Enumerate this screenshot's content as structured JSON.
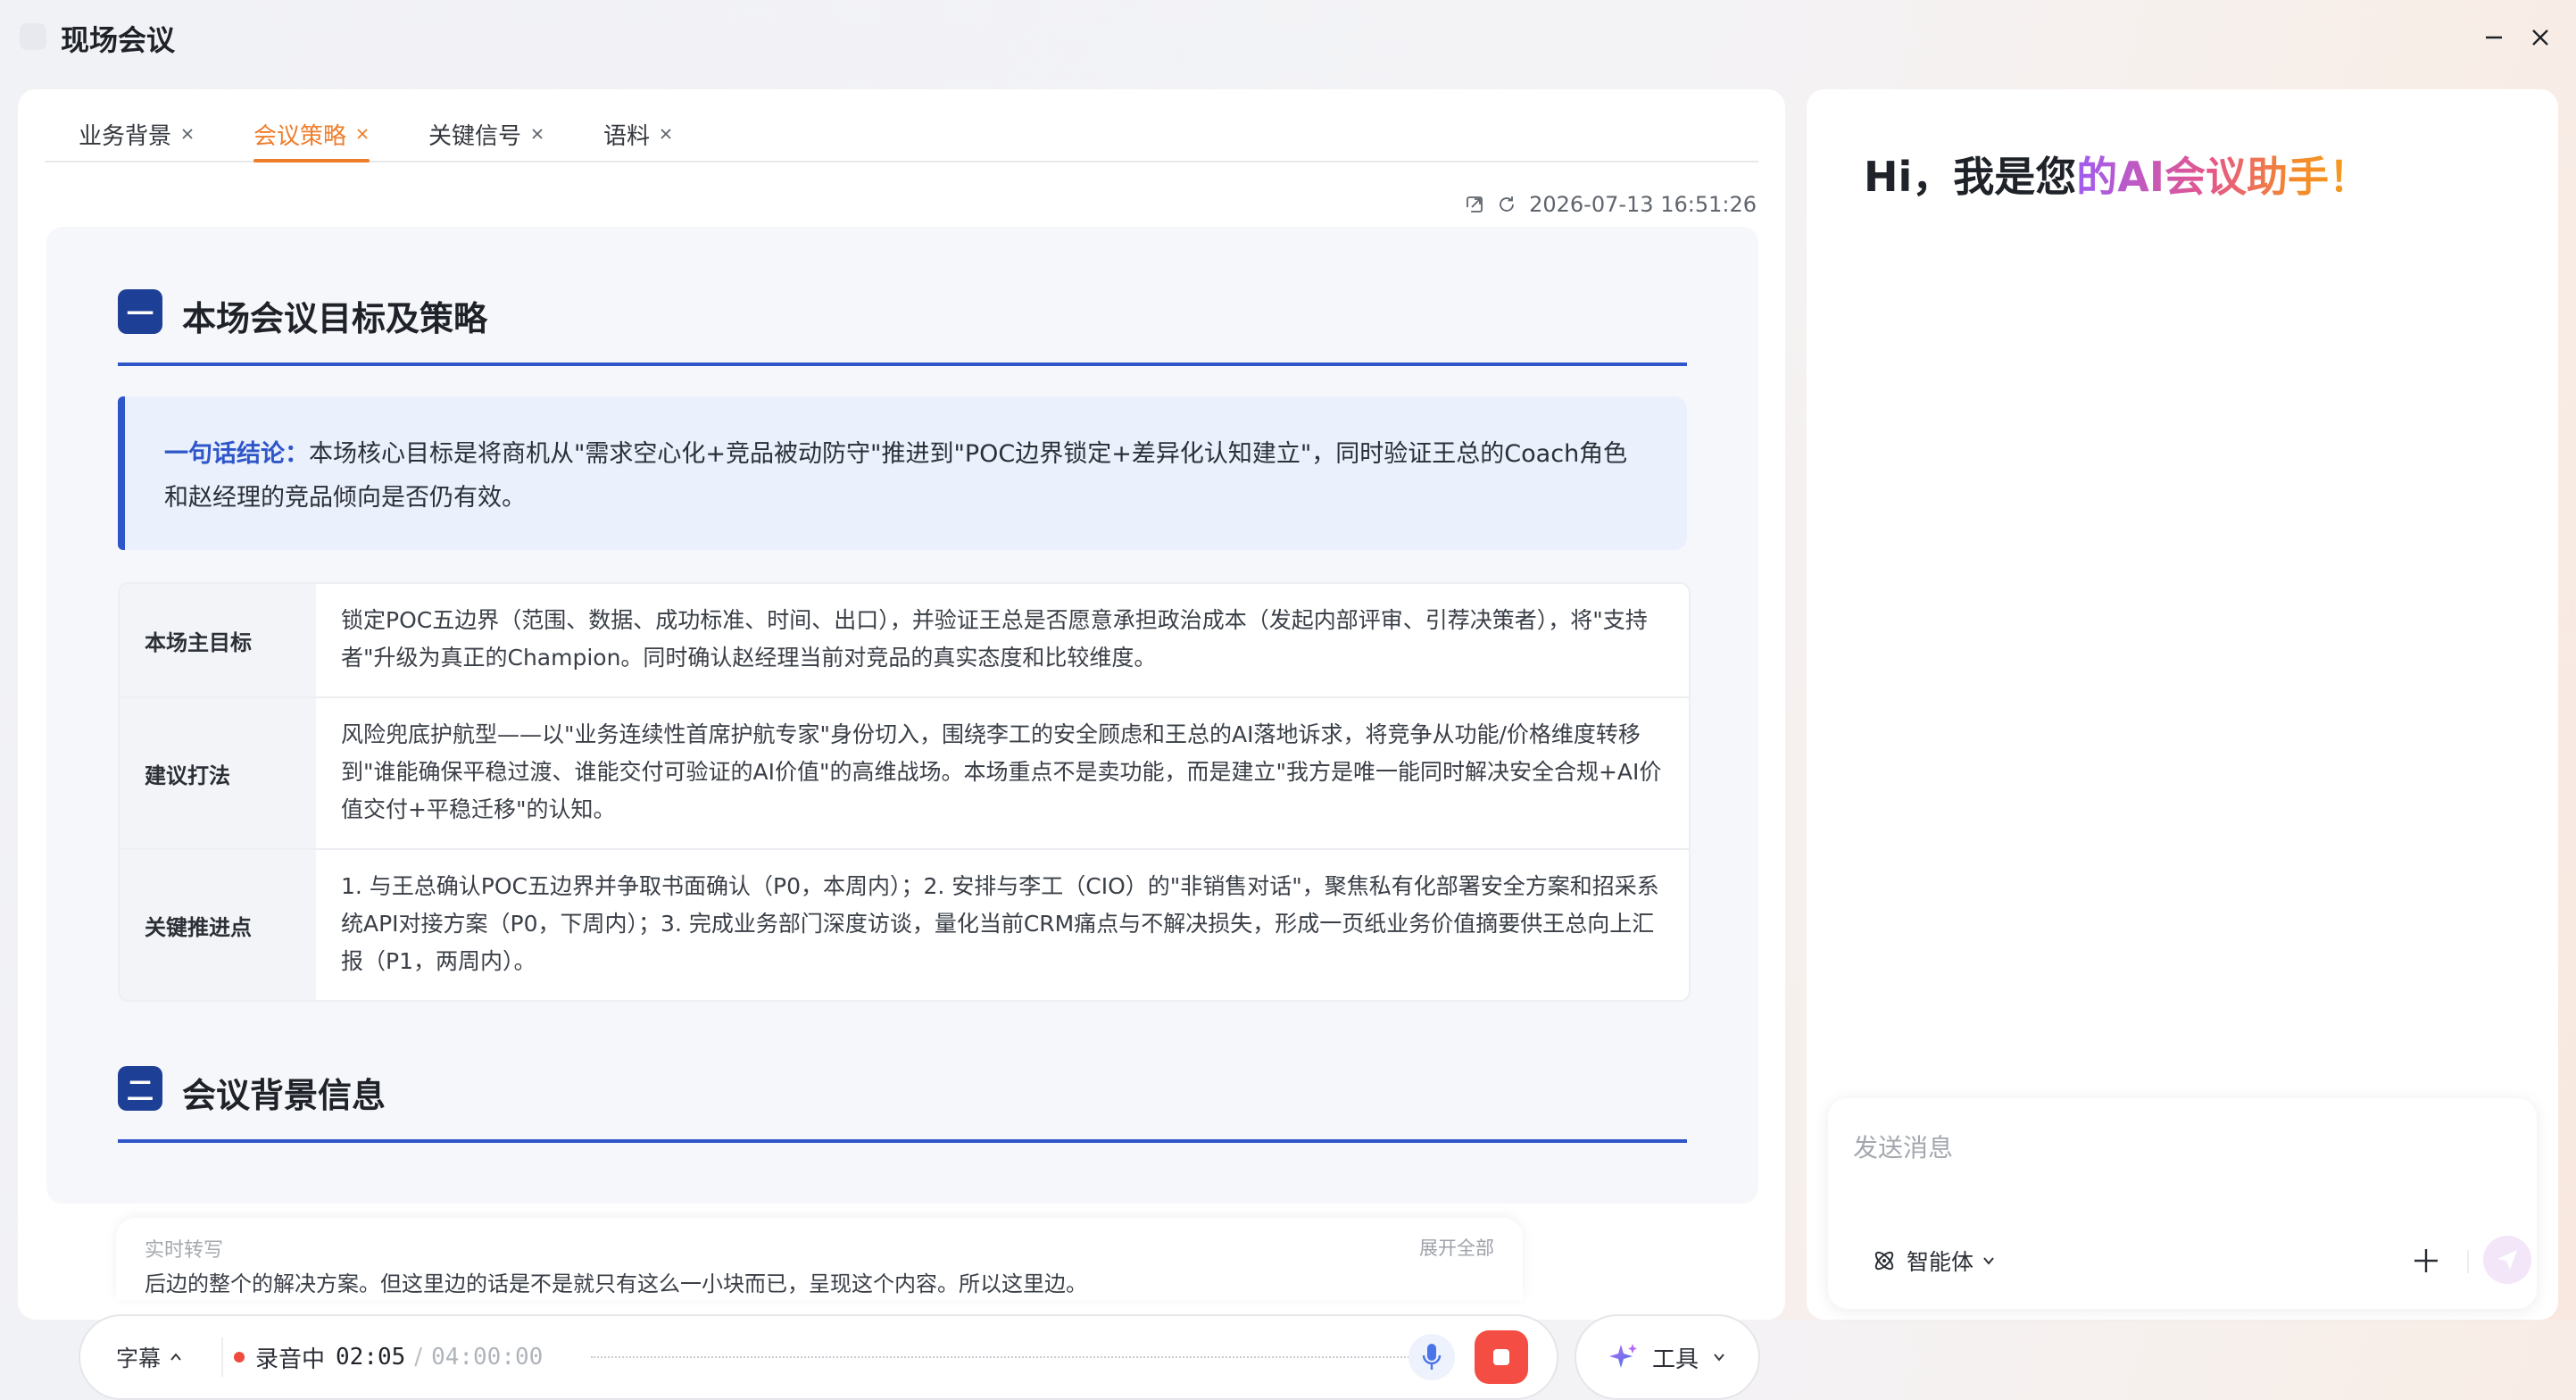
{
  "app": {
    "title": "现场会议"
  },
  "tabs": [
    {
      "label": "业务背景"
    },
    {
      "label": "会议策略"
    },
    {
      "label": "关键信号"
    },
    {
      "label": "语料"
    }
  ],
  "doc_meta": {
    "timestamp": "2026-07-13 16:51:26"
  },
  "section1": {
    "number": "一",
    "title": "本场会议目标及策略",
    "conclusion_lead": "一句话结论：",
    "conclusion_text": "本场核心目标是将商机从\"需求空心化+竞品被动防守\"推进到\"POC边界锁定+差异化认知建立\"，同时验证王总的Coach角色和赵经理的竞品倾向是否仍有效。",
    "rows": [
      {
        "header": "本场主目标",
        "content": "锁定POC五边界（范围、数据、成功标准、时间、出口），并验证王总是否愿意承担政治成本（发起内部评审、引荐决策者），将\"支持者\"升级为真正的Champion。同时确认赵经理当前对竞品的真实态度和比较维度。"
      },
      {
        "header": "建议打法",
        "content": "风险兜底护航型——以\"业务连续性首席护航专家\"身份切入，围绕李工的安全顾虑和王总的AI落地诉求，将竞争从功能/价格维度转移到\"谁能确保平稳过渡、谁能交付可验证的AI价值\"的高维战场。本场重点不是卖功能，而是建立\"我方是唯一能同时解决安全合规+AI价值交付+平稳迁移\"的认知。"
      },
      {
        "header": "关键推进点",
        "content": "1. 与王总确认POC五边界并争取书面确认（P0，本周内）；2. 安排与李工（CIO）的\"非销售对话\"，聚焦私有化部署安全方案和招采系统API对接方案（P0，下周内）；3. 完成业务部门深度访谈，量化当前CRM痛点与不解决损失，形成一页纸业务价值摘要供王总向上汇报（P1，两周内）。"
      }
    ]
  },
  "section2": {
    "number": "二",
    "title": "会议背景信息"
  },
  "transcript": {
    "label": "实时转写",
    "expand": "展开全部",
    "text": "后边的整个的解决方案。但这里边的话是不是就只有这么一小块而已，呈现这个内容。所以这里边。"
  },
  "recorder": {
    "subtitle_label": "字幕",
    "status": "录音中",
    "elapsed": "02:05",
    "separator": "/",
    "total": "04:00:00"
  },
  "tools": {
    "label": "工具"
  },
  "assistant": {
    "greeting_plain": "Hi，我是您",
    "greeting_highlight": "的AI会议助手！"
  },
  "chat_input": {
    "placeholder": "发送消息",
    "agent_label": "智能体"
  },
  "colors": {
    "accent_orange": "#ee7d2b",
    "primary_blue": "#2f56c9",
    "record_red": "#f44d44"
  },
  "icons": [
    "app-logo",
    "minimize-icon",
    "close-icon",
    "tab-close-icon",
    "share-icon",
    "refresh-icon",
    "chevron-up-icon",
    "mic-icon",
    "stop-icon",
    "sparkle-icon",
    "chevron-down-icon",
    "agent-icon",
    "plus-icon",
    "send-icon"
  ]
}
